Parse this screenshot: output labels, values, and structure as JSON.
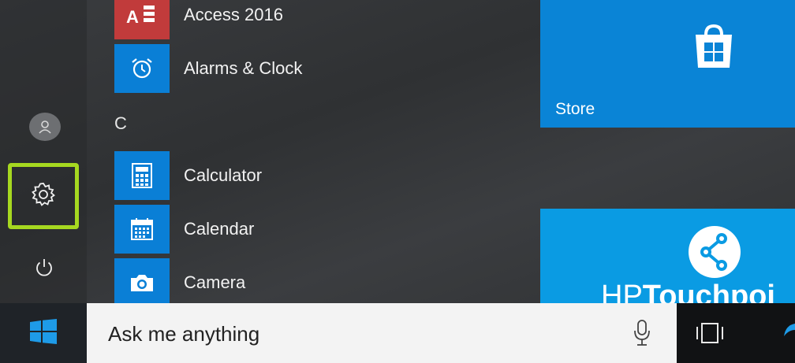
{
  "app_list": {
    "items_top": [
      {
        "label": "Access 2016",
        "color": "#c13b3b",
        "icon": "access-icon"
      },
      {
        "label": "Alarms & Clock",
        "color": "#0a7fd6",
        "icon": "alarm-clock-icon"
      }
    ],
    "section_letter": "C",
    "items_c": [
      {
        "label": "Calculator",
        "color": "#0a7fd6",
        "icon": "calculator-icon"
      },
      {
        "label": "Calendar",
        "color": "#0a7fd6",
        "icon": "calendar-icon"
      },
      {
        "label": "Camera",
        "color": "#0a7fd6",
        "icon": "camera-icon"
      }
    ]
  },
  "rail": {
    "user_icon": "user-avatar-icon",
    "settings_icon": "gear-icon",
    "power_icon": "power-icon",
    "highlight_color": "#a6d820"
  },
  "tiles": {
    "store": {
      "label": "Store",
      "color": "#0a84d6",
      "icon": "store-bag-icon"
    },
    "hp": {
      "text_light": "HP",
      "text_bold": "Touchpoi",
      "color": "#0a9be3",
      "icon": "hp-touchpoint-logo-icon"
    }
  },
  "taskbar": {
    "start_icon": "windows-logo-icon",
    "search_placeholder": "Ask me anything",
    "mic_icon": "microphone-icon",
    "task_view_icon": "task-view-icon",
    "edge_icon": "edge-browser-icon"
  }
}
